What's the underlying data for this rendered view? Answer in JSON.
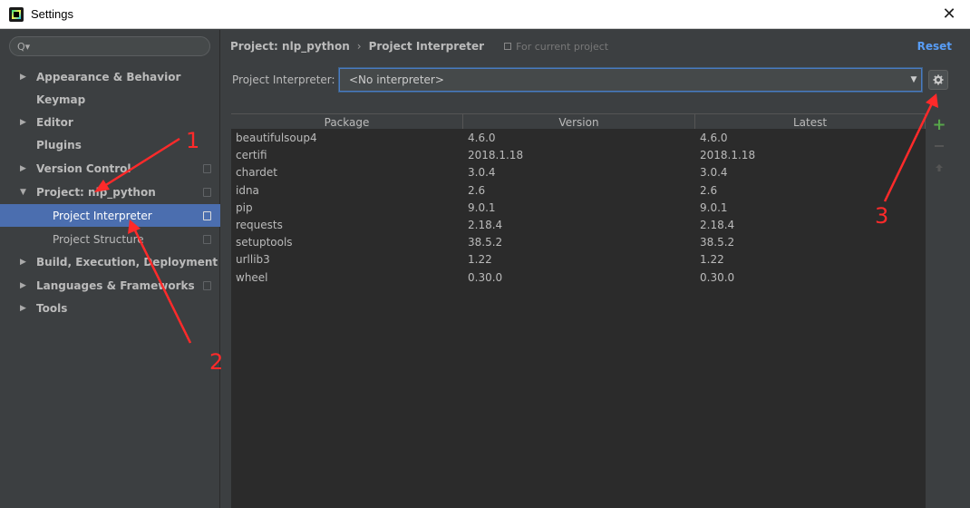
{
  "window": {
    "title": "Settings"
  },
  "search": {
    "placeholder": "Q▾"
  },
  "sidebar": {
    "items": [
      {
        "label": "Appearance & Behavior",
        "expandable": true
      },
      {
        "label": "Keymap",
        "expandable": false
      },
      {
        "label": "Editor",
        "expandable": true
      },
      {
        "label": "Plugins",
        "expandable": false
      },
      {
        "label": "Version Control",
        "expandable": true
      },
      {
        "label": "Project: nlp_python",
        "expandable": true,
        "expanded": true
      },
      {
        "label": "Project Interpreter",
        "sub": true,
        "selected": true
      },
      {
        "label": "Project Structure",
        "sub": true
      },
      {
        "label": "Build, Execution, Deployment",
        "expandable": true
      },
      {
        "label": "Languages & Frameworks",
        "expandable": true
      },
      {
        "label": "Tools",
        "expandable": true
      }
    ]
  },
  "breadcrumb": {
    "project": "Project: nlp_python",
    "separator": "›",
    "page": "Project Interpreter",
    "note": "For current project"
  },
  "reset_label": "Reset",
  "interpreter": {
    "label": "Project Interpreter:",
    "value": "<No interpreter>"
  },
  "table": {
    "headers": [
      "Package",
      "Version",
      "Latest"
    ],
    "rows": [
      [
        "beautifulsoup4",
        "4.6.0",
        "4.6.0"
      ],
      [
        "certifi",
        "2018.1.18",
        "2018.1.18"
      ],
      [
        "chardet",
        "3.0.4",
        "3.0.4"
      ],
      [
        "idna",
        "2.6",
        "2.6"
      ],
      [
        "pip",
        "9.0.1",
        "9.0.1"
      ],
      [
        "requests",
        "2.18.4",
        "2.18.4"
      ],
      [
        "setuptools",
        "38.5.2",
        "38.5.2"
      ],
      [
        "urllib3",
        "1.22",
        "1.22"
      ],
      [
        "wheel",
        "0.30.0",
        "0.30.0"
      ]
    ]
  },
  "annotations": {
    "n1": "1",
    "n2": "2",
    "n3": "3"
  },
  "colors": {
    "accent": "#4b6eaf",
    "link": "#589df6",
    "annotation": "#ff2a2a",
    "add": "#57a64a"
  }
}
